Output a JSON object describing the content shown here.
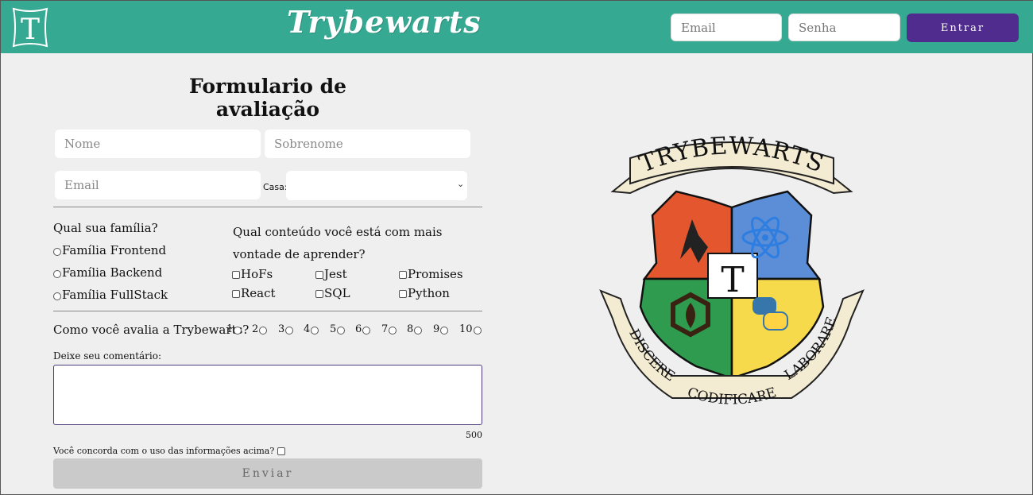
{
  "header": {
    "title": "Trybewarts",
    "logo_letter": "T",
    "login": {
      "email_placeholder": "Email",
      "password_placeholder": "Senha",
      "submit_label": "Entrar"
    }
  },
  "form": {
    "title": "Formulario de avaliação",
    "fields": {
      "name_placeholder": "Nome",
      "lastname_placeholder": "Sobrenome",
      "email_placeholder": "Email",
      "house_label": "Casa:",
      "house_value": ""
    },
    "family": {
      "question": "Qual sua família?",
      "options": [
        "Família Frontend",
        "Família Backend",
        "Família FullStack"
      ]
    },
    "content": {
      "question": "Qual conteúdo você está com mais vontade de aprender?",
      "options": [
        "HoFs",
        "Jest",
        "Promises",
        "React",
        "SQL",
        "Python"
      ]
    },
    "rating": {
      "question": "Como você avalia a Trybewarts?",
      "options": [
        "1",
        "2",
        "3",
        "4",
        "5",
        "6",
        "7",
        "8",
        "9",
        "10"
      ]
    },
    "comment": {
      "label": "Deixe seu comentário:",
      "value": "",
      "counter": "500"
    },
    "agreement": "Você concorda com o uso das informações acima?",
    "submit_label": "Enviar"
  },
  "crest": {
    "banner_top": "TRYBEWARTS",
    "center_letter": "T",
    "motto": [
      "DISCERE",
      "CODIFICARE",
      "LABORARE"
    ]
  },
  "colors": {
    "header_bg": "#36a993",
    "login_button": "#4f2c8e",
    "page_bg": "#efefef",
    "crest_orange": "#e4572e",
    "crest_blue": "#5b8ed6",
    "crest_green": "#2e9b4f",
    "crest_yellow": "#f7d94c"
  }
}
